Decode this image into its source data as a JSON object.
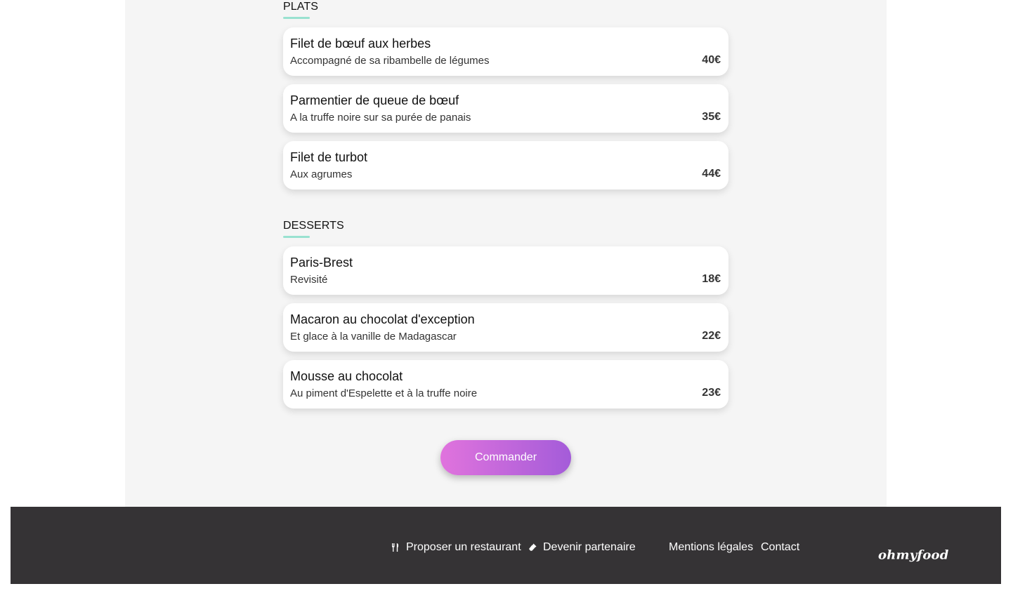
{
  "sections": {
    "plats": {
      "title": "PLATS",
      "items": [
        {
          "name": "Filet de bœuf aux herbes",
          "description": "Accompagné de sa ribambelle de légumes",
          "price": "40€"
        },
        {
          "name": "Parmentier de queue de bœuf",
          "description": "A la truffe noire sur sa purée de panais",
          "price": "35€"
        },
        {
          "name": "Filet de turbot",
          "description": "Aux agrumes",
          "price": "44€"
        }
      ]
    },
    "desserts": {
      "title": "DESSERTS",
      "items": [
        {
          "name": "Paris-Brest",
          "description": "Revisité",
          "price": "18€"
        },
        {
          "name": "Macaron au chocolat d'exception",
          "description": "Et glace à la vanille de Madagascar",
          "price": "22€"
        },
        {
          "name": "Mousse au chocolat",
          "description": "Au piment d'Espelette et à la truffe noire",
          "price": "23€"
        }
      ]
    }
  },
  "order_button": {
    "label": "Commander"
  },
  "footer": {
    "propose_restaurant": {
      "label": "Proposer un restaurant",
      "icon": "utensils-icon"
    },
    "become_partner": {
      "label": "Devenir partenaire",
      "icon": "handshake-icon"
    },
    "legal_mentions": {
      "label": "Mentions légales"
    },
    "contact": {
      "label": "Contact"
    },
    "logo": "ohmyfood"
  },
  "colors": {
    "accent_underline": "#99e2d0",
    "button_gradient_start": "#e073dd",
    "button_gradient_end": "#a45cd9",
    "footer_background": "#353335",
    "panel_background": "#f5f5f5"
  }
}
